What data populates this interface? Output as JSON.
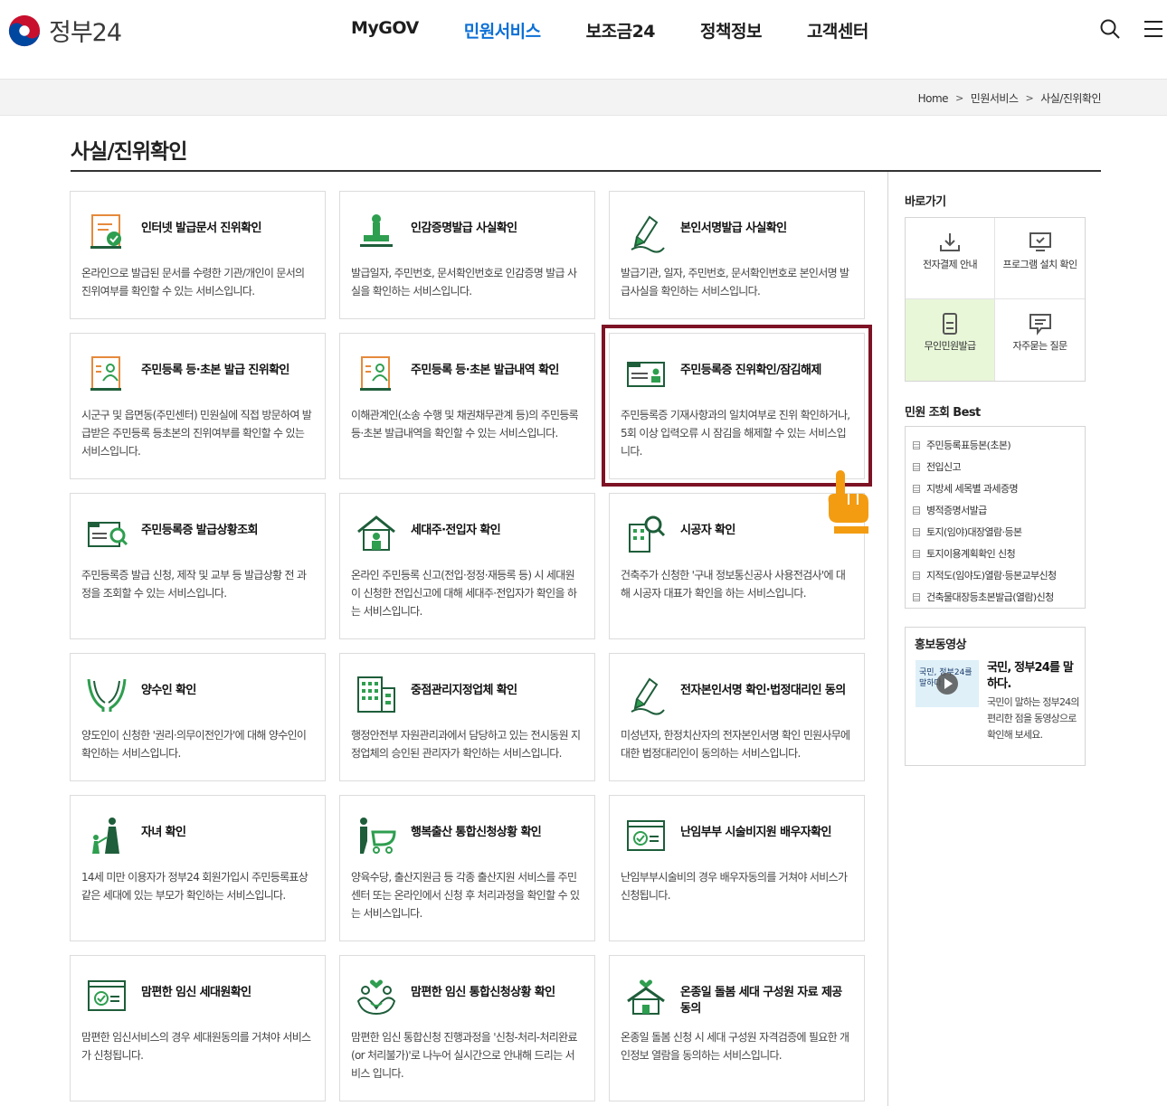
{
  "header": {
    "logo_text": "정부24",
    "nav": [
      "MyGOV",
      "민원서비스",
      "보조금24",
      "정책정보",
      "고객센터"
    ],
    "active_nav": "민원서비스",
    "icons": [
      "search-icon",
      "menu-icon"
    ]
  },
  "breadcrumb": [
    "Home",
    "민원서비스",
    "사실/진위확인"
  ],
  "page_title": "사실/진위확인",
  "cards": [
    {
      "title": "인터넷 발급문서 진위확인",
      "desc": "온라인으로 발급된 문서를 수령한 기관/개인이 문서의 진위여부를 확인할 수 있는 서비스입니다.",
      "icon": "document-check-icon"
    },
    {
      "title": "인감증명발급 사실확인",
      "desc": "발급일자, 주민번호, 문서확인번호로 인감증명 발급 사실을 확인하는 서비스입니다.",
      "icon": "seal-stamp-icon"
    },
    {
      "title": "본인서명발급 사실확인",
      "desc": "발급기관, 일자, 주민번호, 문서확인번호로 본인서명 발급사실을 확인하는 서비스입니다.",
      "icon": "pen-sign-icon"
    },
    {
      "title": "주민등록 등·초본 발급 진위확인",
      "desc": "시군구 및 읍면동(주민센터) 민원실에 직접 방문하여 발급받은 주민등록 등초본의 진위여부를 확인할 수 있는 서비스입니다.",
      "icon": "resident-doc-icon"
    },
    {
      "title": "주민등록 등·초본 발급내역 확인",
      "desc": "이해관계인(소송 수행 및 채권채무관계 등)의 주민등록 등·초본 발급내역을 확인할 수 있는 서비스입니다.",
      "icon": "resident-doc-icon"
    },
    {
      "title": "주민등록증 진위확인/잠김해제",
      "desc": "주민등록증 기재사항과의 일치여부로 진위 확인하거나, 5회 이상 입력오류 시 잠김을 해제할 수 있는 서비스입니다.",
      "icon": "id-card-icon"
    },
    {
      "title": "주민등록증 발급상황조회",
      "desc": "주민등록증 발급 신청, 제작 및 교부 등 발급상황 전 과정을 조회할 수 있는 서비스입니다.",
      "icon": "id-card-search-icon"
    },
    {
      "title": "세대주·전입자 확인",
      "desc": "온라인 주민등록 신고(전입·정정·재등록 등) 시 세대원이 신청한 전입신고에 대해 세대주·전입자가 확인을 하는 서비스입니다.",
      "icon": "house-person-icon"
    },
    {
      "title": "시공자 확인",
      "desc": "건축주가 신청한 '구내 정보통신공사 사용전검사'에 대해 시공자 대표가 확인을 하는 서비스입니다.",
      "icon": "building-search-icon"
    },
    {
      "title": "양수인 확인",
      "desc": "양도인이 신청한 '권리·의무이전인가'에 대해 양수인이 확인하는 서비스입니다.",
      "icon": "hands-icon"
    },
    {
      "title": "중점관리지정업체 확인",
      "desc": "행정안전부 자원관리과에서 담당하고 있는 전시동원 지정업체의 승인된 관리자가 확인하는 서비스입니다.",
      "icon": "office-building-icon"
    },
    {
      "title": "전자본인서명 확인·법정대리인 동의",
      "desc": "미성년자, 한정치산자의 전자본인서명 확인 민원사무에 대한 법정대리인이 동의하는 서비스입니다.",
      "icon": "pen-sign-icon"
    },
    {
      "title": "자녀 확인",
      "desc": "14세 미만 이용자가 정부24 회원가입시 주민등록표상 같은 세대에 있는 부모가 확인하는 서비스입니다.",
      "icon": "parent-child-icon"
    },
    {
      "title": "행복출산 통합신청상황 확인",
      "desc": "양육수당, 출산지원금 등 각종 출산지원 서비스를 주민센터 또는 온라인에서 신청 후 처리과정을 확인할 수 있는 서비스입니다.",
      "icon": "stroller-icon"
    },
    {
      "title": "난임부부 시술비지원 배우자확인",
      "desc": "난임부부시술비의 경우 배우자동의를 거쳐야 서비스가 신청됩니다.",
      "icon": "check-window-icon"
    },
    {
      "title": "맘편한 임신 세대원확인",
      "desc": "맘편한 임신서비스의 경우 세대원동의를 거쳐야 서비스가 신청됩니다.",
      "icon": "check-window-icon"
    },
    {
      "title": "맘편한 임신 통합신청상황 확인",
      "desc": "맘편한 임신 통합신청 진행과정을 '신청-처리-처리완료(or 처리불가)'로 나누어 실시간으로 안내해 드리는 서비스 입니다.",
      "icon": "family-heart-icon"
    },
    {
      "title": "온종일 돌봄 세대 구성원 자료 제공 동의",
      "desc": "온종일 돌봄 신청 시 세대 구성원 자격검증에 필요한 개인정보 열람을 동의하는 서비스입니다.",
      "icon": "house-heart-icon"
    }
  ],
  "sidebar": {
    "quick_heading": "바로가기",
    "quick": [
      {
        "label": "전자결제 안내",
        "icon": "download-icon"
      },
      {
        "label": "프로그램 설치 확인",
        "icon": "monitor-check-icon"
      },
      {
        "label": "무인민원발급",
        "icon": "kiosk-icon"
      },
      {
        "label": "자주묻는 질문",
        "icon": "chat-icon"
      }
    ],
    "best_heading": "민원 조회 Best",
    "best": [
      "주민등록표등본(초본)",
      "전입신고",
      "지방세 세목별 과세증명",
      "병적증명서발급",
      "토지(임야)대장열람·등본",
      "토지이용계획확인 신청",
      "지적도(임야도)열람·등본교부신청",
      "건축물대장등초본발급(열람)신청"
    ],
    "promo_heading": "홍보동영상",
    "promo_title": "국민, 정부24를 말하다.",
    "promo_desc": "국민이 말하는 정부24의 편리한 점을 동영상으로 확인해 보세요.",
    "promo_thumb_text": "국민, 정부24를 말하다"
  },
  "colors": {
    "accent": "#0b6fd6",
    "highlight": "#7d1324",
    "icon_green": "#2e7d32",
    "hand": "#f39c12"
  }
}
